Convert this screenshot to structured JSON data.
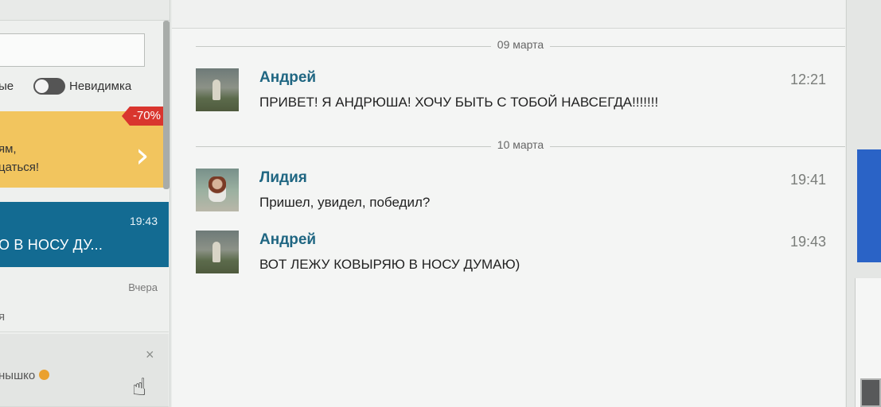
{
  "left_panel": {
    "status_left_label": "ые",
    "invisible_toggle_label": "Невидимка",
    "promo": {
      "badge": "-70%",
      "line1": "ям,",
      "line2": "цаться!"
    },
    "active_chat": {
      "time": "19:43",
      "preview": "О В НОСУ ДУ..."
    },
    "chat_1": {
      "time": "Вчера",
      "preview": "я"
    },
    "chat_2": {
      "close": "×",
      "preview": "нышко"
    }
  },
  "conversation": {
    "date_separators": [
      "09 марта",
      "10 марта"
    ],
    "messages": [
      {
        "sender": "Андрей",
        "time": "12:21",
        "text": "ПРИВЕТ! Я АНДРЮША! ХОЧУ БЫТЬ С ТОБОЙ НАВСЕГДА!!!!!!!"
      },
      {
        "sender": "Лидия",
        "time": "19:41",
        "text": "Пришел, увидел, победил?"
      },
      {
        "sender": "Андрей",
        "time": "19:43",
        "text": "ВОТ ЛЕЖУ КОВЫРЯЮ В НОСУ ДУМАЮ)"
      }
    ]
  },
  "colors": {
    "accent_blue": "#136b92",
    "sender_name": "#1f6682",
    "promo_yellow": "#f2c55e",
    "discount_red": "#d9352e"
  },
  "icons": {
    "toggle": "toggle-switch-icon",
    "promo_arrow": "chevron-right-icon",
    "close": "close-icon",
    "emoji": "sun-emoji-icon",
    "cursor": "hand-pointer-icon"
  }
}
